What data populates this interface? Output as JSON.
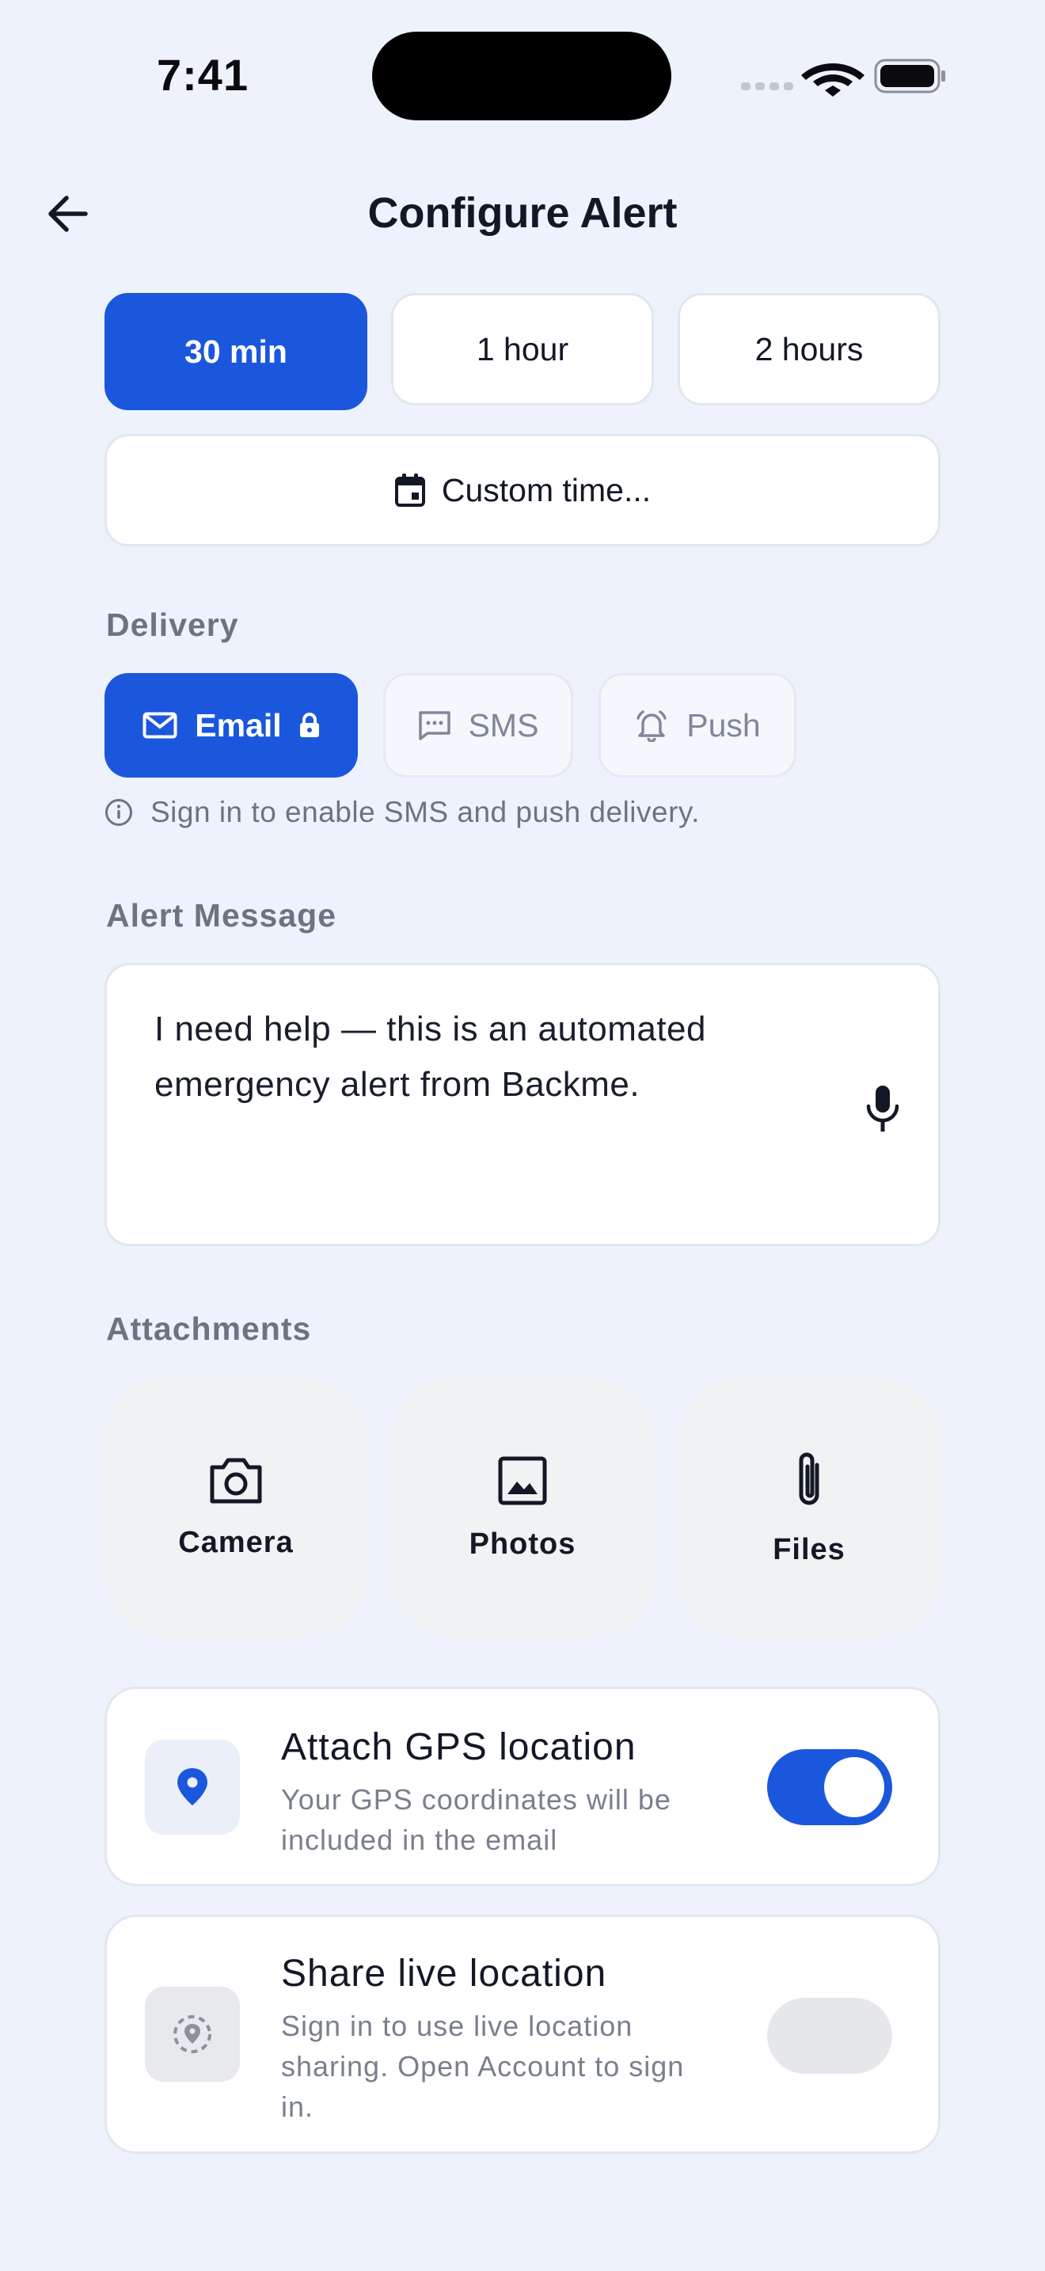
{
  "status_bar": {
    "time": "7:41"
  },
  "header": {
    "title": "Configure Alert"
  },
  "duration": {
    "options": [
      "30 min",
      "1 hour",
      "2 hours"
    ],
    "selected": "30 min",
    "custom_label": "Custom time..."
  },
  "delivery": {
    "label": "Delivery",
    "email_label": "Email",
    "sms_label": "SMS",
    "push_label": "Push",
    "selected": "Email",
    "hint": "Sign in to enable SMS and push delivery."
  },
  "message": {
    "label": "Alert Message",
    "value": "I need help — this is an automated emergency alert from Backme."
  },
  "attachments": {
    "label": "Attachments",
    "camera": "Camera",
    "photos": "Photos",
    "files": "Files"
  },
  "gps": {
    "title": "Attach GPS location",
    "description": "Your GPS coordinates will be included in the email",
    "enabled": true
  },
  "live_location": {
    "title": "Share live location",
    "description": "Sign in to use live location sharing. Open Account to sign in.",
    "enabled": false
  },
  "colors": {
    "accent": "#1B57DD",
    "background": "#EEF2FC"
  }
}
